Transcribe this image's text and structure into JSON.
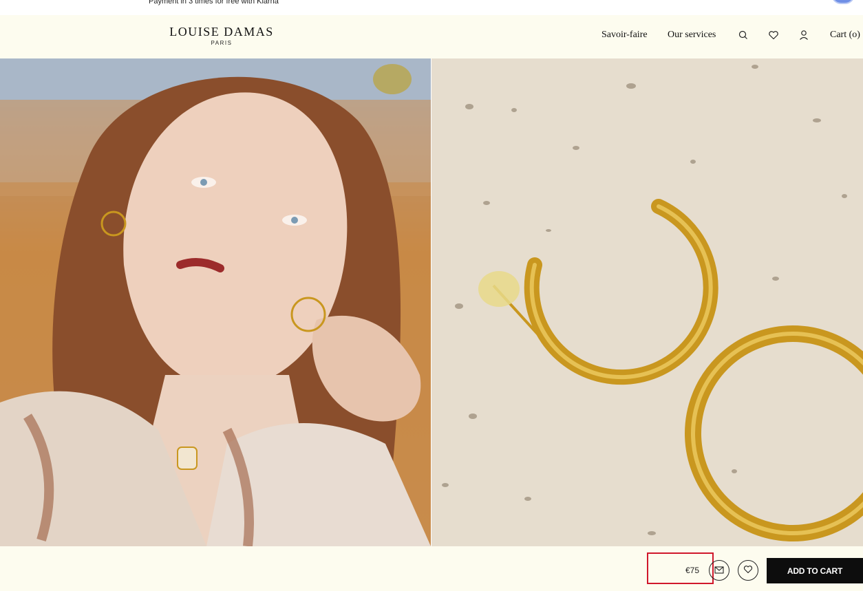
{
  "promo": {
    "text": "Payment in 3 times for free with Klarna"
  },
  "header": {
    "logo_name": "LOUISE DAMAS",
    "logo_city": "PARIS",
    "nav": {
      "savoir_faire": "Savoir-faire",
      "services": "Our services",
      "cart": "Cart (o)"
    },
    "icons": [
      "search-icon",
      "heart-icon",
      "user-icon"
    ]
  },
  "gallery": {
    "images": [
      "model-wearing-gold-hoops",
      "gold-hoop-earrings-on-stone"
    ]
  },
  "buybar": {
    "price": "€75",
    "add_to_cart": "ADD TO CART",
    "icons": [
      "mail-icon",
      "heart-icon"
    ]
  },
  "colors": {
    "header_bg": "#fdfcef",
    "button_bg": "#0d0d0d",
    "highlight": "#d0172b",
    "gold": "#c9971f"
  }
}
